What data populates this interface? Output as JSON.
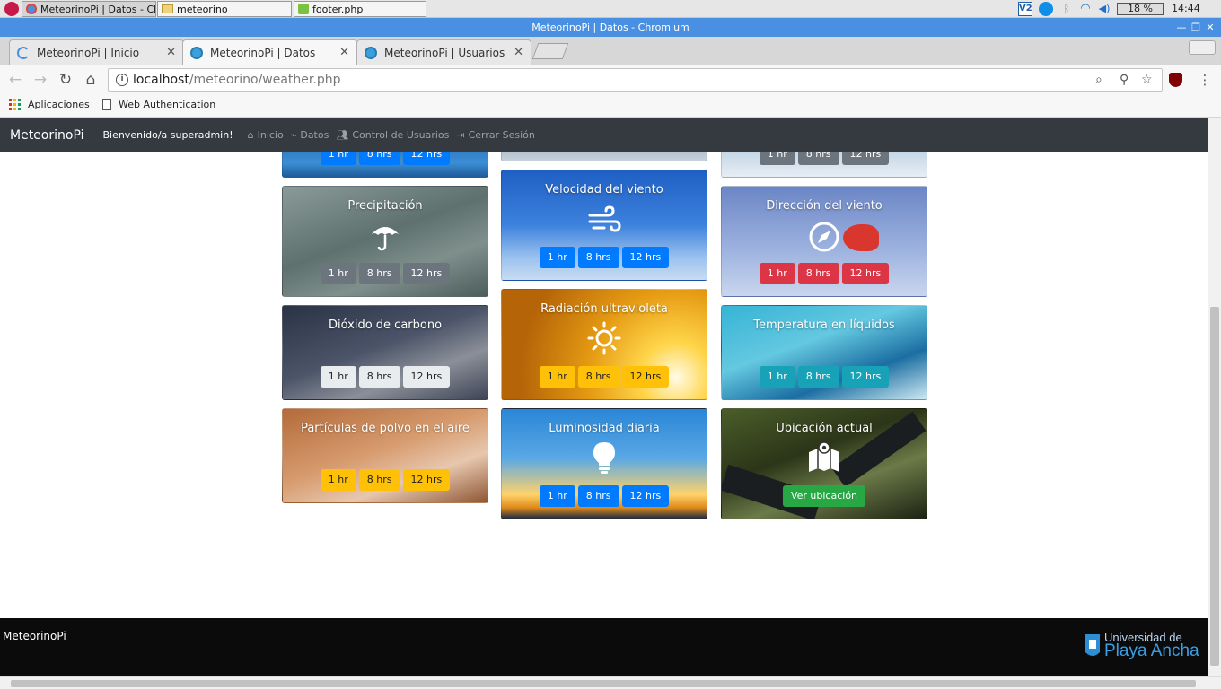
{
  "taskbar": {
    "items": [
      "MeteorinoPi | Datos - Ch...",
      "meteorino",
      "footer.php"
    ],
    "battery": "18 %",
    "clock": "14:44"
  },
  "window": {
    "title": "MeteorinoPi | Datos - Chromium"
  },
  "tabs": [
    {
      "label": "MeteorinoPi | Inicio"
    },
    {
      "label": "MeteorinoPi | Datos"
    },
    {
      "label": "MeteorinoPi | Usuarios"
    }
  ],
  "address": {
    "host": "localhost",
    "path": "/meteorino/weather.php"
  },
  "bookmarks": [
    "Aplicaciones",
    "Web Authentication"
  ],
  "navbar": {
    "brand": "MeteorinoPi",
    "welcome": "Bienvenido/a superadmin!",
    "links": [
      "Inicio",
      "Datos",
      "Control de Usuarios",
      "Cerrar Sesión"
    ]
  },
  "top_partial_buttons": {
    "left": [
      "1 hr",
      "8 hrs",
      "12 hrs"
    ],
    "right": [
      "1 hr",
      "8 hrs",
      "12 hrs"
    ]
  },
  "cards": [
    {
      "title": "Precipitación",
      "icon": "umbrella-icon",
      "buttons": [
        "1 hr",
        "8 hrs",
        "12 hrs"
      ],
      "style": "secondary"
    },
    {
      "title": "Velocidad del viento",
      "icon": "wind-icon",
      "buttons": [
        "1 hr",
        "8 hrs",
        "12 hrs"
      ],
      "style": "primary"
    },
    {
      "title": "Dirección del viento",
      "icon": "compass-icon",
      "buttons": [
        "1 hr",
        "8 hrs",
        "12 hrs"
      ],
      "style": "danger"
    },
    {
      "title": "Dióxido de carbono",
      "icon": "",
      "buttons": [
        "1 hr",
        "8 hrs",
        "12 hrs"
      ],
      "style": "light"
    },
    {
      "title": "Radiación ultravioleta",
      "icon": "sun-icon",
      "buttons": [
        "1 hr",
        "8 hrs",
        "12 hrs"
      ],
      "style": "warning"
    },
    {
      "title": "Temperatura en líquidos",
      "icon": "",
      "buttons": [
        "1 hr",
        "8 hrs",
        "12 hrs"
      ],
      "style": "info"
    },
    {
      "title": "Partículas de polvo en el aire",
      "icon": "",
      "buttons": [
        "1 hr",
        "8 hrs",
        "12 hrs"
      ],
      "style": "warning"
    },
    {
      "title": "Luminosidad diaria",
      "icon": "lightbulb-icon",
      "buttons": [
        "1 hr",
        "8 hrs",
        "12 hrs"
      ],
      "style": "primary"
    },
    {
      "title": "Ubicación actual",
      "icon": "map-icon",
      "buttons": [
        "Ver ubicación"
      ],
      "style": "success"
    }
  ],
  "footer": {
    "brand": "MeteorinoPi",
    "logo_line1": "Universidad de",
    "logo_line2": "Playa Ancha"
  }
}
